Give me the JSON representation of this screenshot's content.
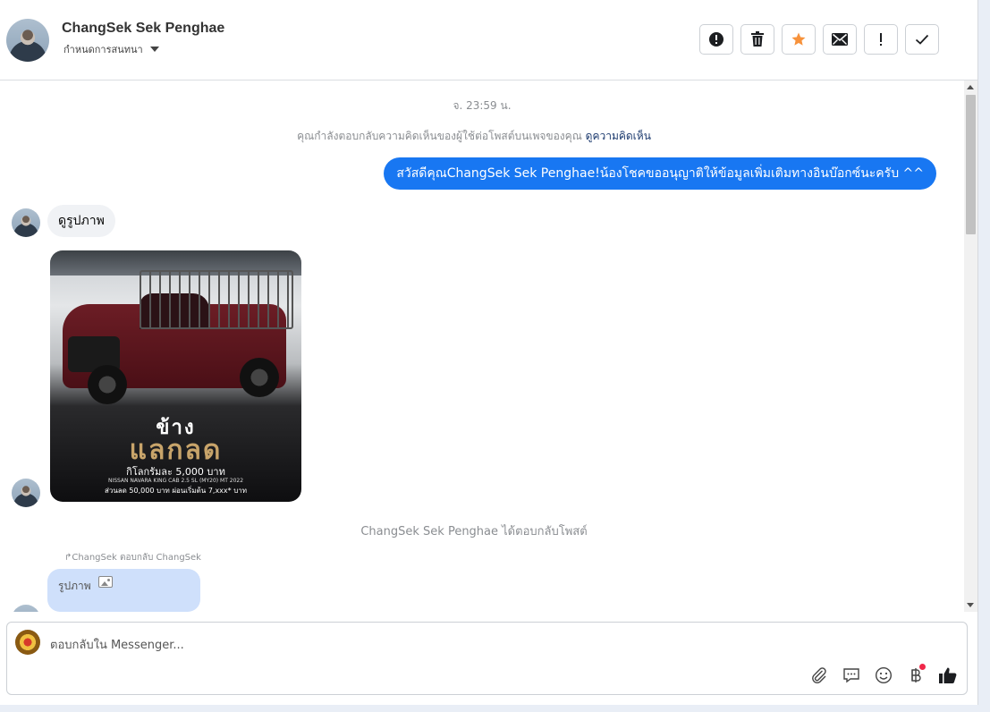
{
  "header": {
    "contact_name": "ChangSek Sek Penghae",
    "subtitle": "กำหนดการสนทนา",
    "actions": [
      {
        "name": "report-spam-button",
        "icon": "exclamation-circle-icon"
      },
      {
        "name": "delete-button",
        "icon": "trash-icon"
      },
      {
        "name": "star-button",
        "icon": "star-icon"
      },
      {
        "name": "mark-unread-button",
        "icon": "envelope-icon"
      },
      {
        "name": "follow-up-button",
        "icon": "exclamation-icon"
      },
      {
        "name": "mark-done-button",
        "icon": "check-icon"
      }
    ],
    "star_color": "#f7923b"
  },
  "conversation": {
    "timestamp": "จ. 23:59 น.",
    "notice_text": "คุณกำลังตอบกลับความคิดเห็นของผู้ใช้ต่อโพสต์บนเพจของคุณ",
    "notice_link": "ดูความคิดเห็น",
    "outgoing_message": "สวัสดีคุณChangSek Sek Penghae!น้องโชคขออนุญาติให้ข้อมูลเพิ่มเติมทางอินบ๊อกซ์นะครับ ^^",
    "incoming_message": "ดูรูปภาพ",
    "photo_text": {
      "line1": "ข้าง",
      "line2": "แลกลด",
      "line3": "กิโลกรัมละ 5,000 บาท",
      "line4": "NISSAN NAVARA KING CAB 2.5 SL (MY20) MT 2022",
      "line5": "ส่วนลด 50,000 บาท   ผ่อนเริ่มต้น 7,xxx* บาท"
    },
    "reply_event": "ChangSek Sek Penghae ได้ตอบกลับโพสต์",
    "reply_reference": "↱ChangSek ตอบกลับ ChangSek",
    "reply_bubble_text": "รูปภาพ",
    "outgoing_color": "#1877f2"
  },
  "composer": {
    "placeholder": "ตอบกลับใน Messenger...",
    "tools": [
      "paperclip-icon",
      "speech-bubble-icon",
      "smiley-icon",
      "baht-icon",
      "thumbs-up-icon"
    ]
  }
}
